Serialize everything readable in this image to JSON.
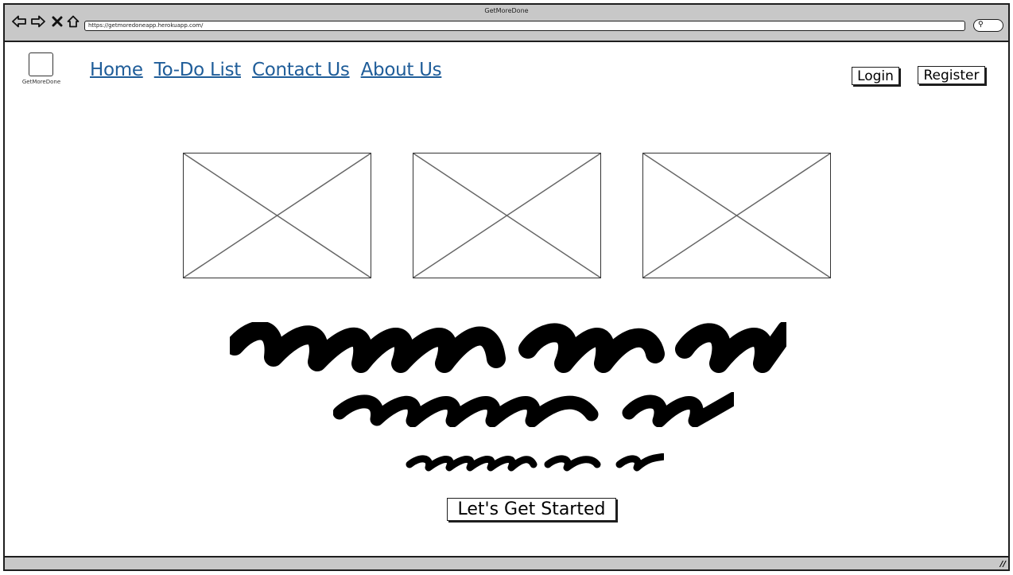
{
  "window": {
    "title": "GetMoreDone",
    "url": "https://getmoredoneapp.herokuapp.com/"
  },
  "icons": {
    "back": "arrow-left-icon",
    "forward": "arrow-right-icon",
    "stop": "close-icon",
    "home": "home-icon",
    "search": "search-icon",
    "resize": "resize-grip-icon"
  },
  "header": {
    "logo_label": "GetMoreDone",
    "nav": [
      "Home",
      "To-Do List",
      "Contact Us",
      "About Us"
    ],
    "login_label": "Login",
    "register_label": "Register"
  },
  "main": {
    "cta_label": "Let's Get Started"
  },
  "colors": {
    "link": "#1f5d99",
    "chrome": "#c8c8c8"
  }
}
